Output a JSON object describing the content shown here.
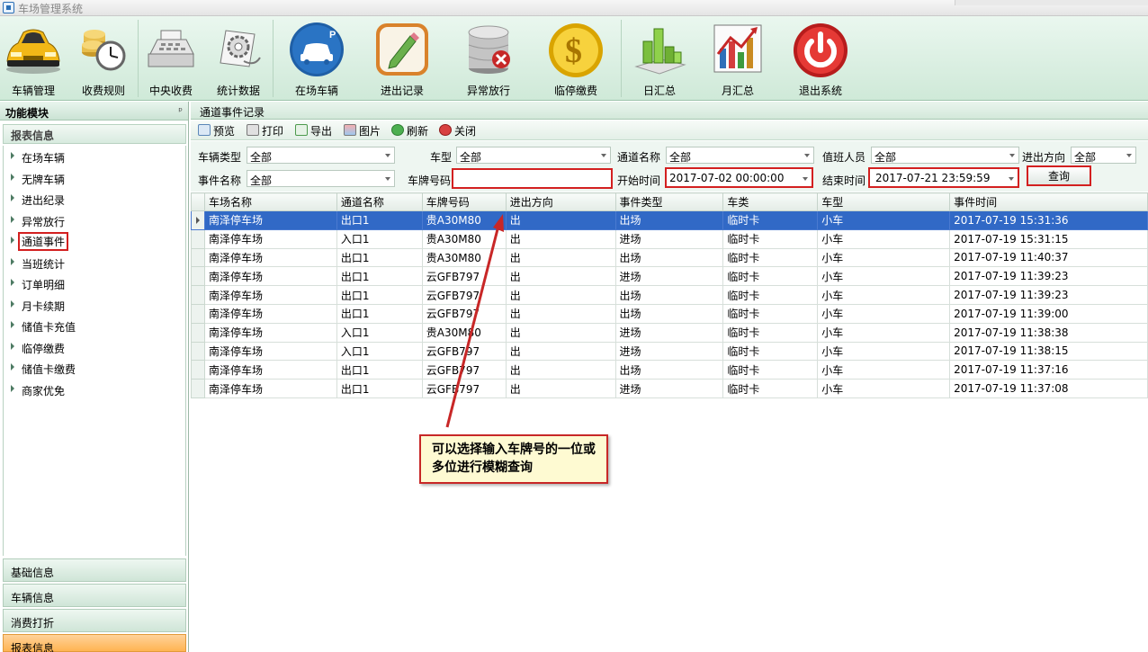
{
  "window": {
    "title": "车场管理系统"
  },
  "toolbar": {
    "items": [
      {
        "label": "车辆管理",
        "icon": "car-icon"
      },
      {
        "label": "收费规则",
        "icon": "coins-clock-icon"
      },
      {
        "label": "中央收费",
        "icon": "cash-register-icon"
      },
      {
        "label": "统计数据",
        "icon": "gear-document-icon"
      },
      {
        "label": "在场车辆",
        "icon": "parking-car-icon"
      },
      {
        "label": "进出记录",
        "icon": "edit-record-icon"
      },
      {
        "label": "异常放行",
        "icon": "database-error-icon"
      },
      {
        "label": "临停缴费",
        "icon": "dollar-coin-icon"
      },
      {
        "label": "日汇总",
        "icon": "bar-chart-icon"
      },
      {
        "label": "月汇总",
        "icon": "trend-chart-icon"
      },
      {
        "label": "退出系统",
        "icon": "power-icon"
      }
    ]
  },
  "left_panel": {
    "title": "功能模块",
    "pin": "ᵖ",
    "section": "报表信息",
    "items": [
      "在场车辆",
      "无牌车辆",
      "进出纪录",
      "异常放行",
      "通道事件",
      "当班统计",
      "订单明细",
      "月卡续期",
      "储值卡充值",
      "临停缴费",
      "储值卡缴费",
      "商家优免"
    ],
    "selected": "通道事件",
    "categories": [
      "基础信息",
      "车辆信息",
      "消费打折",
      "报表信息"
    ]
  },
  "main": {
    "title": "通道事件记录",
    "tools": [
      "预览",
      "打印",
      "导出",
      "图片",
      "刷新",
      "关闭"
    ],
    "filters": {
      "vehicle_type_label": "车辆类型",
      "vehicle_type": "全部",
      "car_model_label": "车型",
      "car_model": "全部",
      "channel_name_label": "通道名称",
      "channel_name": "全部",
      "duty_staff_label": "值班人员",
      "duty_staff": "全部",
      "direction_label": "进出方向",
      "direction": "全部",
      "event_name_label": "事件名称",
      "event_name": "全部",
      "plate_label": "车牌号码",
      "plate": "",
      "start_label": "开始时间",
      "start": "2017-07-02 00:00:00",
      "end_label": "结束时间",
      "end": "2017-07-21 23:59:59",
      "query_button": "查询"
    },
    "table": {
      "headers": [
        "车场名称",
        "通道名称",
        "车牌号码",
        "进出方向",
        "事件类型",
        "车类",
        "车型",
        "事件时间"
      ],
      "rows": [
        [
          "南泽停车场",
          "出口1",
          "贵A30M80",
          "出",
          "出场",
          "临时卡",
          "小车",
          "2017-07-19 15:31:36"
        ],
        [
          "南泽停车场",
          "入口1",
          "贵A30M80",
          "出",
          "进场",
          "临时卡",
          "小车",
          "2017-07-19 15:31:15"
        ],
        [
          "南泽停车场",
          "出口1",
          "贵A30M80",
          "出",
          "出场",
          "临时卡",
          "小车",
          "2017-07-19 11:40:37"
        ],
        [
          "南泽停车场",
          "出口1",
          "云GFB797",
          "出",
          "进场",
          "临时卡",
          "小车",
          "2017-07-19 11:39:23"
        ],
        [
          "南泽停车场",
          "出口1",
          "云GFB797",
          "出",
          "出场",
          "临时卡",
          "小车",
          "2017-07-19 11:39:23"
        ],
        [
          "南泽停车场",
          "出口1",
          "云GFB797",
          "出",
          "出场",
          "临时卡",
          "小车",
          "2017-07-19 11:39:00"
        ],
        [
          "南泽停车场",
          "入口1",
          "贵A30M80",
          "出",
          "进场",
          "临时卡",
          "小车",
          "2017-07-19 11:38:38"
        ],
        [
          "南泽停车场",
          "入口1",
          "云GFB797",
          "出",
          "进场",
          "临时卡",
          "小车",
          "2017-07-19 11:38:15"
        ],
        [
          "南泽停车场",
          "出口1",
          "云GFB797",
          "出",
          "出场",
          "临时卡",
          "小车",
          "2017-07-19 11:37:16"
        ],
        [
          "南泽停车场",
          "出口1",
          "云GFB797",
          "出",
          "进场",
          "临时卡",
          "小车",
          "2017-07-19 11:37:08"
        ]
      ],
      "selected_row": 0
    }
  },
  "annotation": {
    "text": "可以选择输入车牌号的一位或多位进行模糊查询"
  },
  "colors": {
    "highlight_red": "#d32020",
    "row_selected": "#3169c6",
    "toolbar_bg": "#cfe9d8",
    "active_category": "#ffb452"
  }
}
